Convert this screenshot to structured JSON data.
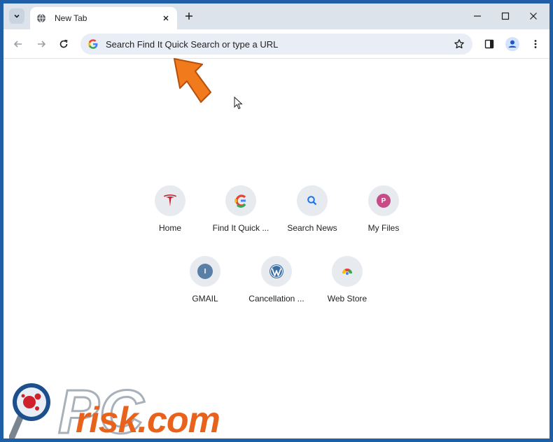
{
  "tab": {
    "title": "New Tab"
  },
  "omnibox": {
    "placeholder": "Search Find It Quick Search or type a URL"
  },
  "shortcuts": [
    {
      "label": "Home",
      "icon": "tesla-icon"
    },
    {
      "label": "Find It Quick ...",
      "icon": "find-it-quick-icon"
    },
    {
      "label": "Search News",
      "icon": "search-icon"
    },
    {
      "label": "My Files",
      "icon": "letter-p-icon",
      "letter": "P"
    },
    {
      "label": "GMAIL",
      "icon": "letter-i-icon",
      "letter": "I"
    },
    {
      "label": "Cancellation ...",
      "icon": "wordpress-icon"
    },
    {
      "label": "Web Store",
      "icon": "chrome-web-store-icon"
    }
  ],
  "watermark": {
    "brand_pc": "PC",
    "brand_rest": "risk.com"
  },
  "colors": {
    "arrow": "#f07a1c",
    "brand_orange": "#e8621b",
    "letter_p": "#c64b86",
    "letter_i": "#5a7fa6"
  }
}
